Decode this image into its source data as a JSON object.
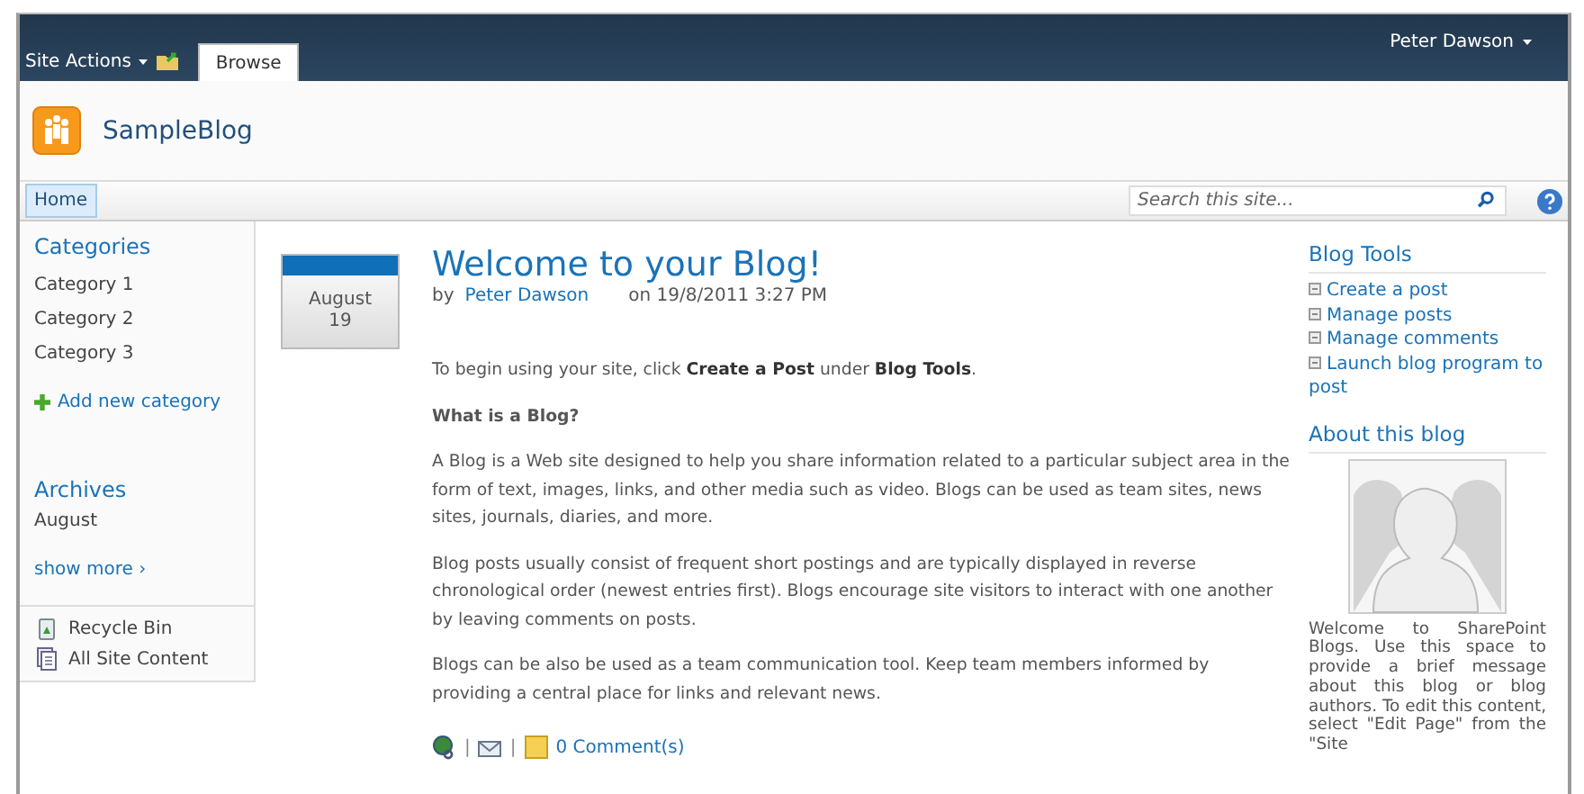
{
  "top_bar": {
    "site_actions": "Site Actions",
    "tabs": [
      {
        "label": "Browse",
        "selected": true
      }
    ],
    "user": "Peter Dawson"
  },
  "header": {
    "site_title": "SampleBlog"
  },
  "nav": {
    "tabs": [
      {
        "label": "Home",
        "selected": true
      }
    ],
    "search": {
      "placeholder": "Search this site..."
    }
  },
  "left_nav": {
    "categories": {
      "heading": "Categories",
      "items": [
        "Category 1",
        "Category 2",
        "Category 3"
      ],
      "add_link": "Add new category"
    },
    "archives": {
      "heading": "Archives",
      "items": [
        "August"
      ],
      "show_more": "show more ›"
    },
    "links": [
      {
        "kind": "recycle",
        "label": "Recycle Bin"
      },
      {
        "kind": "content",
        "label": "All Site Content"
      }
    ]
  },
  "post": {
    "date": {
      "month": "August",
      "day": "19"
    },
    "title": "Welcome to your Blog!",
    "by": "by",
    "author": "Peter Dawson",
    "posted_on": "on 19/8/2011 3:27 PM",
    "paragraphs": [
      {
        "kind": "text",
        "text": "To begin using your site, click **Create a Post** under **Blog Tools**."
      },
      {
        "kind": "heading",
        "text": "What is a Blog?"
      },
      {
        "kind": "text",
        "text": "A Blog is a Web site designed to help you share information related to a particular subject area in the form of text, images, links, and other media such as video. Blogs can be used as team sites, news sites, journals, diaries, and more."
      },
      {
        "kind": "text",
        "text": "Blog posts usually consist of frequent short postings and are typically displayed in reverse chronological order (newest entries first). Blogs encourage site visitors to interact with one another by leaving comments on posts."
      },
      {
        "kind": "text",
        "text": "Blogs can be also be used as a team communication tool. Keep team members informed by providing a central place for links and relevant news."
      }
    ],
    "separators": [
      "|",
      "|"
    ],
    "comments": "0 Comment(s)"
  },
  "right": {
    "blog_tools": {
      "heading": "Blog Tools",
      "items": [
        "Create a post",
        "Manage posts",
        "Manage comments",
        "Launch blog program to post"
      ]
    },
    "about": {
      "heading": "About this blog",
      "text": "Welcome to SharePoint Blogs. Use this space to provide a brief message about this blog or blog authors. To edit this content, select \"Edit Page\" from the \"Site"
    }
  }
}
